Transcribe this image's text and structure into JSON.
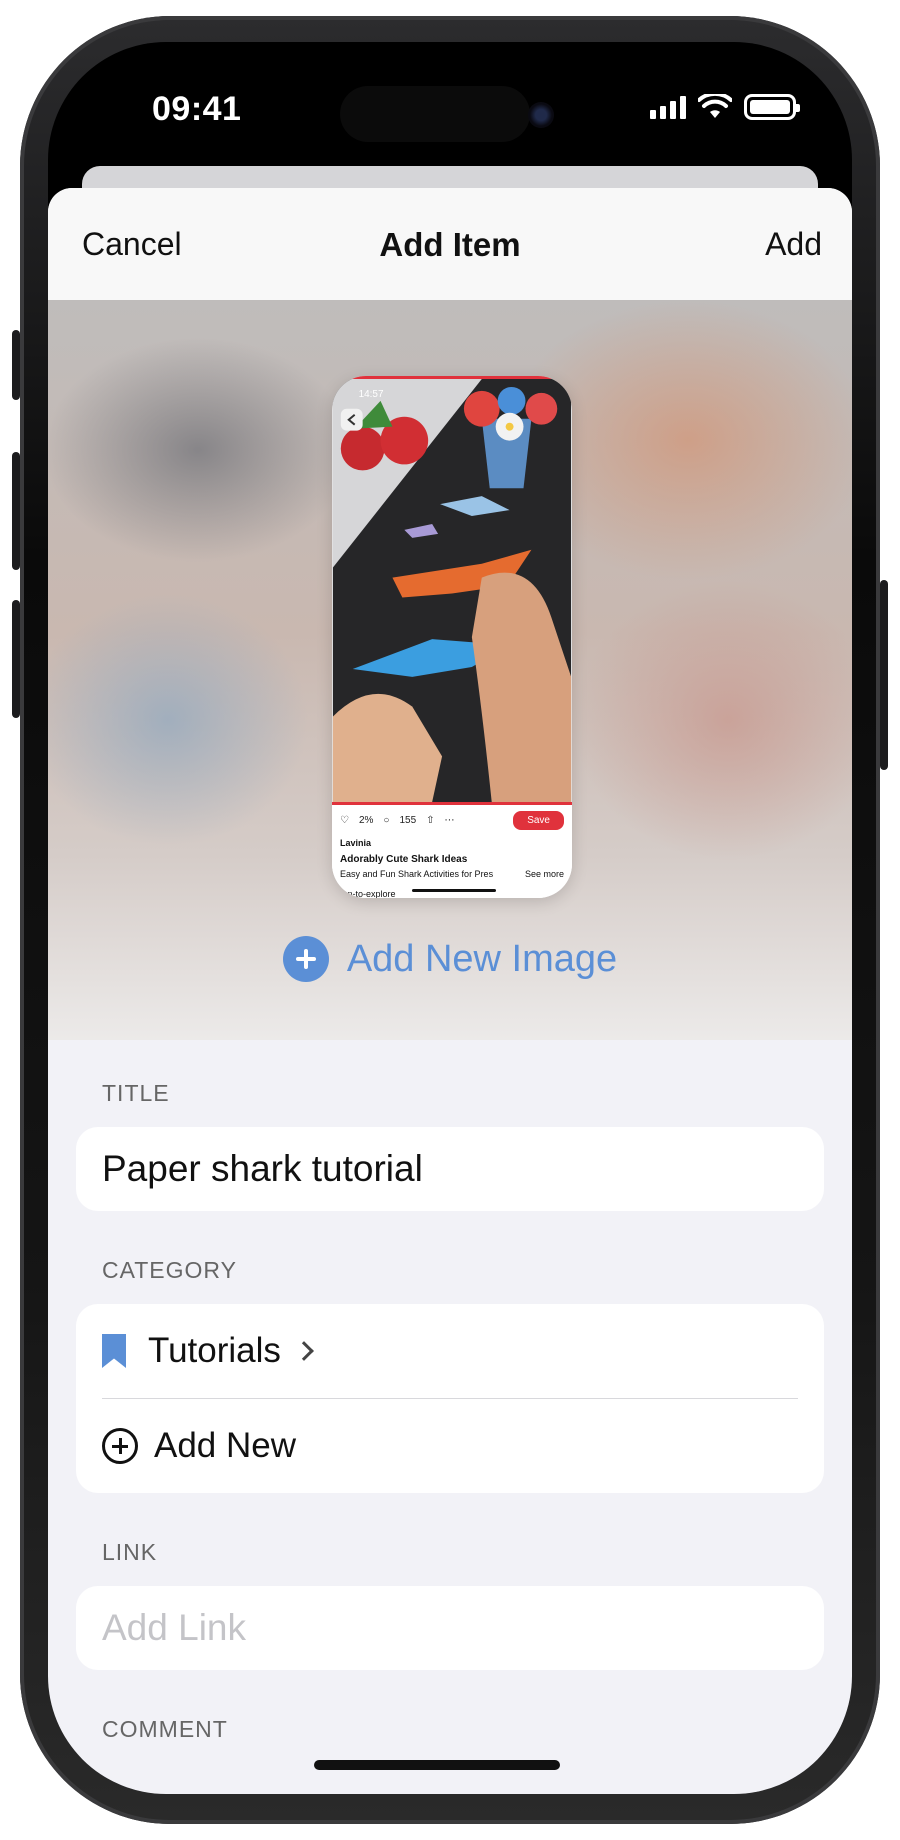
{
  "status_bar": {
    "time": "09:41"
  },
  "navbar": {
    "cancel_label": "Cancel",
    "title": "Add Item",
    "add_label": "Add"
  },
  "thumbnail": {
    "time": "14:57",
    "likes": "2%",
    "comments": "155",
    "save_label": "Save",
    "author": "Lavinia",
    "headline": "Adorably Cute Shark Ideas",
    "description": "Easy and Fun Shark Activities for Pres",
    "see_more": "See more",
    "footer": "...n-to-explore"
  },
  "add_image_label": "Add New Image",
  "title_section": {
    "label": "TITLE",
    "value": "Paper shark tutorial"
  },
  "category_section": {
    "label": "CATEGORY",
    "selected": "Tutorials",
    "add_new_label": "Add New"
  },
  "link_section": {
    "label": "LINK",
    "placeholder": "Add Link"
  },
  "comment_section": {
    "label": "COMMENT"
  },
  "colors": {
    "accent": "#5b8fd6",
    "save_red": "#e0323c"
  }
}
